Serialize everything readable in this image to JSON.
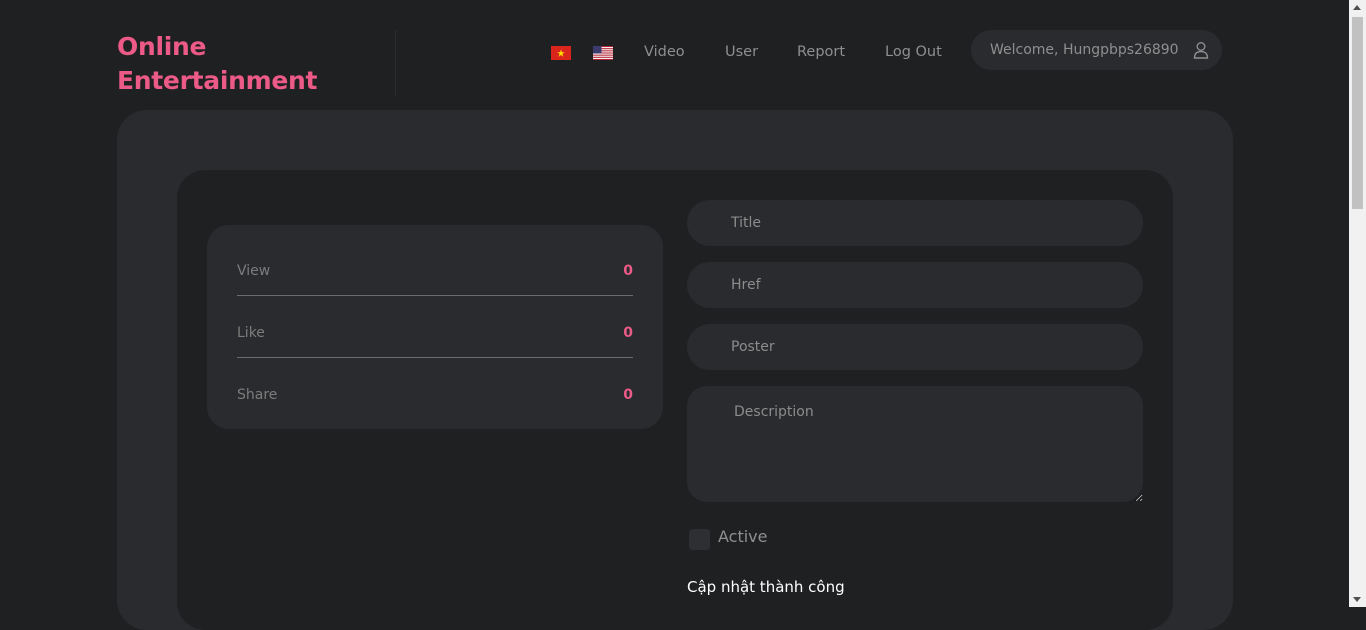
{
  "brand": {
    "line1": "Online",
    "line2": "Entertainment",
    "color": "#ec5a87"
  },
  "nav": {
    "flags": [
      {
        "name": "vietnam-flag-icon"
      },
      {
        "name": "us-flag-icon"
      }
    ],
    "items": [
      "Video",
      "User",
      "Report",
      "Log Out"
    ],
    "welcome": "Welcome, Hungpbps26890",
    "welcome_icon": "user-icon"
  },
  "stats": [
    {
      "label": "View",
      "value": "0"
    },
    {
      "label": "Like",
      "value": "0"
    },
    {
      "label": "Share",
      "value": "0"
    }
  ],
  "form": {
    "title_placeholder": "Title",
    "title_value": "",
    "href_placeholder": "Href",
    "href_value": "",
    "poster_placeholder": "Poster",
    "poster_value": "",
    "description_placeholder": "Description",
    "description_value": "",
    "active_label": "Active",
    "active_checked": false
  },
  "status_message": "Cập nhật thành công",
  "colors": {
    "background": "#1f2022",
    "panel": "#2a2b2e",
    "accent": "#ec5a87",
    "text_muted": "#8f8f8f"
  }
}
